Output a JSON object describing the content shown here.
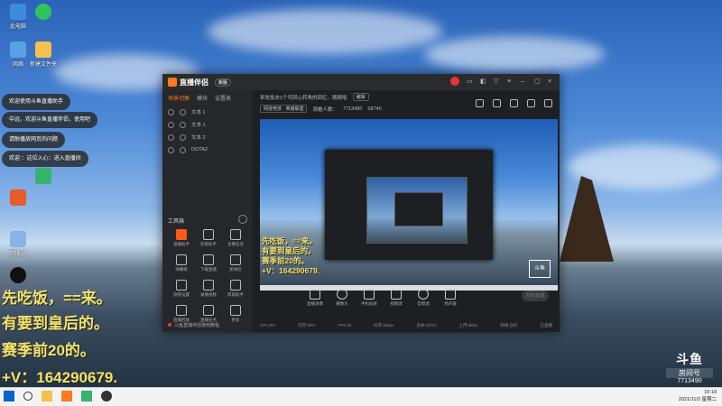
{
  "desktop": {
    "icons": [
      {
        "label": "此电脑"
      },
      {
        "label": "网络"
      },
      {
        "label": "新建文件夹"
      },
      {
        "label": "回收站"
      },
      {
        "label": "腾讯QQ"
      }
    ],
    "toasts": [
      "欢迎使用斗鱼直播助手",
      "中远，欢迎斗鱼直播伴侣，使用吧",
      "请耐播放网页的问题",
      "欢迎       ：这位入心：进入直播间"
    ],
    "overlay_lines": [
      "先吃饭，==来。",
      "有要到皇后的。",
      "赛季前20的。",
      "+V：164290679."
    ],
    "brand": {
      "name": "斗鱼",
      "room_label": "房间号",
      "room_number": "7713490"
    }
  },
  "app": {
    "title": "直播伴侣",
    "version_badge": "新版",
    "sidebar_tabs": [
      "场景切换",
      "模块",
      "设置表"
    ],
    "scenes": [
      "文本 1",
      "文本 1",
      "文本 2",
      "DOTA2"
    ],
    "tools_title": "工具箱",
    "tools": [
      {
        "label": "直播助手",
        "hot": true
      },
      {
        "label": "房管助手"
      },
      {
        "label": "主播任务"
      },
      {
        "label": "弹幕姬"
      },
      {
        "label": "下载直播"
      },
      {
        "label": "新闻栏"
      },
      {
        "label": "旋转设置"
      },
      {
        "label": "录播视频"
      },
      {
        "label": "获取助手"
      },
      {
        "label": "直播回放"
      },
      {
        "label": "直播任务"
      },
      {
        "label": "更多"
      }
    ],
    "sidebar_footer": "斗鱼直播伴侣使用教程",
    "info": {
      "title": "来吃饭去1个可回心转角的回忆。随随啦",
      "tag": "编辑",
      "category": "网游竞技 · 英雄联盟",
      "watching": "观看人数：",
      "room": "7713490",
      "heat": "58740"
    },
    "preview": {
      "overlay_lines": [
        "先吃饭，==来。",
        "有要到皇后的。",
        "赛季前20的。",
        "+V：164290679."
      ],
      "logo": "斗鱼"
    },
    "bottom_buttons": [
      "直播录像",
      "摄像头",
      "手机投屏",
      "视频源",
      "音频源",
      "扬声器"
    ],
    "go_live": "开始直播",
    "status": [
      "CPU:8%",
      "内存:50%",
      "FPS:30",
      "码率:0kbps",
      "丢帧:0(0%)",
      "上传:0kb/s",
      "网络:良好",
      "已直播"
    ]
  },
  "taskbar": {
    "time": "15:19",
    "date": "2021/11/2 星期二"
  }
}
